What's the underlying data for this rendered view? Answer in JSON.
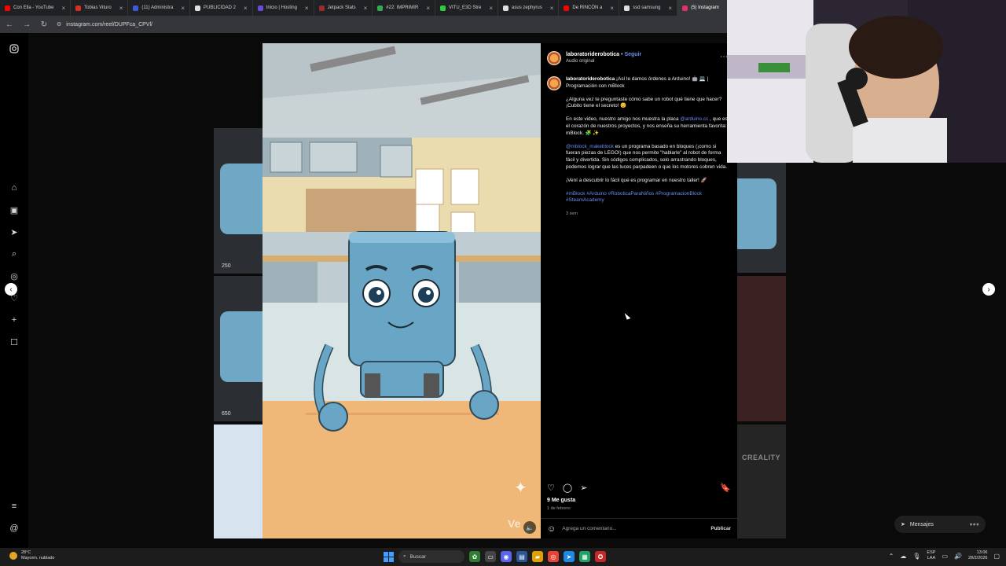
{
  "browser": {
    "tabs": [
      {
        "label": "Con Ella - YouTube",
        "color": "#ff0000"
      },
      {
        "label": "Tobias Vituro",
        "color": "#d93025"
      },
      {
        "label": "(11) Administra",
        "color": "#3b5bdb"
      },
      {
        "label": "PUBLICIDAD 2",
        "color": "#e0e0e0"
      },
      {
        "label": "Inicio | Hosting",
        "color": "#6b4bd8"
      },
      {
        "label": "Jetpack Stats",
        "color": "#9c2b2b"
      },
      {
        "label": "#22: IMPRIMIR",
        "color": "#34a853"
      },
      {
        "label": "VITU_E3D Stre",
        "color": "#2ecc40"
      },
      {
        "label": "asus zephyrus",
        "color": "#e0e0e0"
      },
      {
        "label": "De RINCÓN a",
        "color": "#ff0000"
      },
      {
        "label": "ssd samsung",
        "color": "#e0e0e0"
      },
      {
        "label": "(5) Instagram",
        "color": "#e1306c"
      }
    ],
    "url": "instagram.com/reel/DUPFca_CPVl/"
  },
  "post": {
    "username": "laboratoriderobotica",
    "follow_label": "Seguir",
    "audio_label": "Audio original",
    "caption_user": "laboratoriderobotica",
    "caption_lead": "¡Así le damos órdenes a Arduino! 🤖 💻 | Programación con mBlock",
    "para1": "¿Alguna vez te preguntaste cómo sabe un robot qué tiene que hacer? ¡Cubito tiene el secreto! 😊",
    "para2_pre": "En este video, nuestro amigo nos muestra la placa ",
    "para2_link": "@arduino.cc",
    "para2_post": " , que es el corazón de nuestros proyectos, y nos enseña su herramienta favorita: mBlock. 🧩 ✨",
    "para3_link": "@mblock_makeblock",
    "para3_post": " es un programa basado en bloques (¡como si fueran piezas de LEGO!) que nos permite \"hablarle\" al robot de forma fácil y divertida. Sin códigos complicados, solo arrastrando bloques, podemos lograr que las luces parpadeen o que los motores cobren vida.",
    "para4": "¡Vení a descubrir lo fácil que es programar en nuestro taller! 🚀",
    "hashtags": "#mBlock #Arduino #RoboticaParaNiños #ProgramacionBlock #SteamAcademy",
    "caption_time": "3 sem",
    "likes": "9 Me gusta",
    "date": "1 de febrero",
    "comment_placeholder": "Agrega un comentario...",
    "publish_label": "Publicar",
    "watermark": "Ve"
  },
  "thumbs": {
    "count_top": "250",
    "count_bottom": "650"
  },
  "right_side": {
    "creality": "CREALITY",
    "messages_label": "Mensajes"
  },
  "taskbar": {
    "temp": "28°C",
    "weather": "Mayorm. nublado",
    "search_label": "Buscar",
    "lang_top": "ESP",
    "lang_bottom": "LAA",
    "time": "13:06",
    "date": "28/2/2026"
  }
}
